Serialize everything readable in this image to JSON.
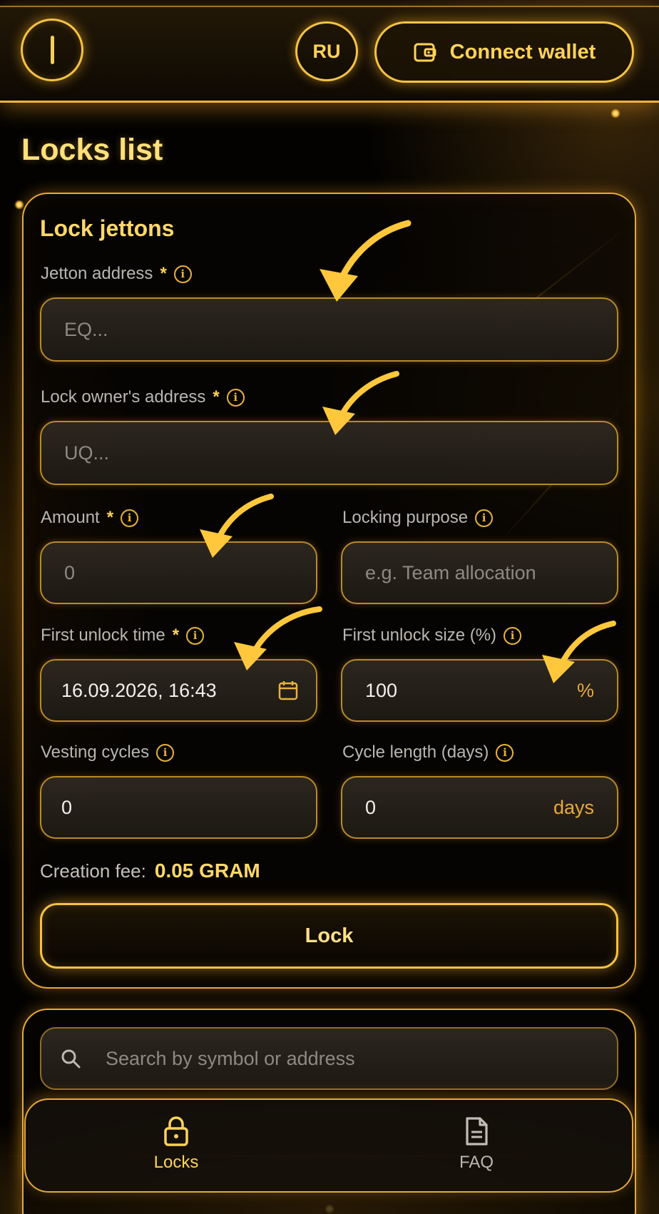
{
  "header": {
    "language": "RU",
    "connect_wallet": "Connect wallet"
  },
  "page": {
    "title": "Locks list"
  },
  "form": {
    "title": "Lock jettons",
    "jetton_address": {
      "label": "Jetton address",
      "required": "*",
      "placeholder": "EQ..."
    },
    "owner_address": {
      "label": "Lock owner's address",
      "required": "*",
      "placeholder": "UQ..."
    },
    "amount": {
      "label": "Amount",
      "required": "*",
      "placeholder": "0"
    },
    "purpose": {
      "label": "Locking purpose",
      "placeholder": "e.g. Team allocation"
    },
    "first_unlock_time": {
      "label": "First unlock time",
      "required": "*",
      "value": "16.09.2026, 16:43"
    },
    "first_unlock_size": {
      "label": "First unlock size (%)",
      "value": "100",
      "suffix": "%"
    },
    "vesting_cycles": {
      "label": "Vesting cycles",
      "value": "0"
    },
    "cycle_length": {
      "label": "Cycle length (days)",
      "value": "0",
      "suffix": "days"
    },
    "fee_label": "Creation fee:",
    "fee_value": "0.05 GRAM",
    "submit_label": "Lock"
  },
  "search": {
    "placeholder": "Search by symbol or address"
  },
  "nav": {
    "items": [
      {
        "label": "Locks",
        "icon": "lock-icon",
        "active": true
      },
      {
        "label": "FAQ",
        "icon": "document-icon",
        "active": false
      }
    ]
  },
  "colors": {
    "accent": "#ffd25a",
    "border": "#e4a93a",
    "background": "#030201"
  }
}
